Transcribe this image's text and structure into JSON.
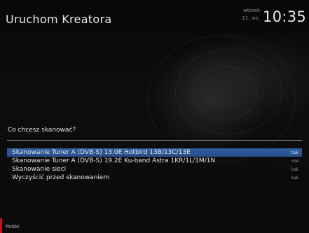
{
  "header": {
    "title": "Uruchom Kreatora",
    "day": "wtorek",
    "date": "11. sie.",
    "time": "10:35"
  },
  "prompt": "Co chcesz skanować?",
  "options": [
    {
      "label": "Skanowanie Tuner A (DVB-S) 13.0E Hotbird 13B/13C/13E",
      "value": "tak",
      "selected": true
    },
    {
      "label": "Skanowanie Tuner A (DVB-S) 19.2E Ku-band Astra 1KR/1L/1M/1N",
      "value": "nie",
      "selected": false
    },
    {
      "label": "Skanowanie sieci",
      "value": "tak",
      "selected": false
    },
    {
      "label": "Wyczyścić przed skanowaniem",
      "value": "tak",
      "selected": false
    }
  ],
  "footer": {
    "language": "Polski"
  },
  "colors": {
    "selection": "#2f5f9f",
    "red_button": "#c01818"
  }
}
